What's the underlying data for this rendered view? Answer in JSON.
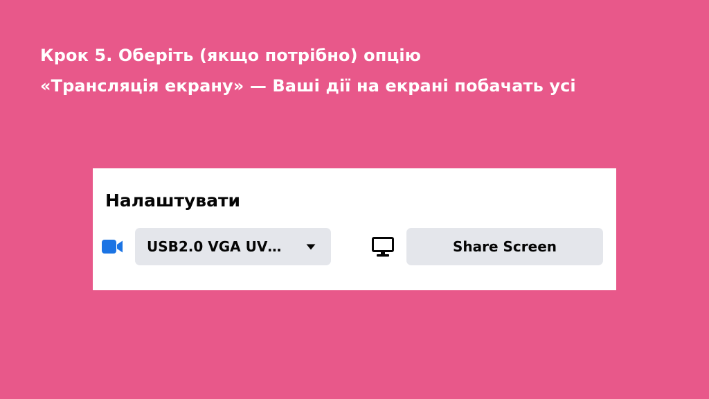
{
  "slide": {
    "heading_line1": "Крок 5. Оберіть (якщо потрібно) опцію",
    "heading_line2": "«Трансляція екрану» — Ваші дії на екрані побачать усі"
  },
  "panel": {
    "title": "Налаштувати",
    "camera": {
      "icon": "video-camera-icon",
      "selected_value": "USB2.0 VGA UV…",
      "dropdown_icon": "caret-down-icon"
    },
    "share": {
      "icon": "monitor-icon",
      "button_label": "Share Screen"
    }
  },
  "colors": {
    "background": "#e8588a",
    "panel": "#ffffff",
    "control_fill": "#e4e6eb",
    "camera_icon": "#1b74e4",
    "text": "#050505"
  }
}
